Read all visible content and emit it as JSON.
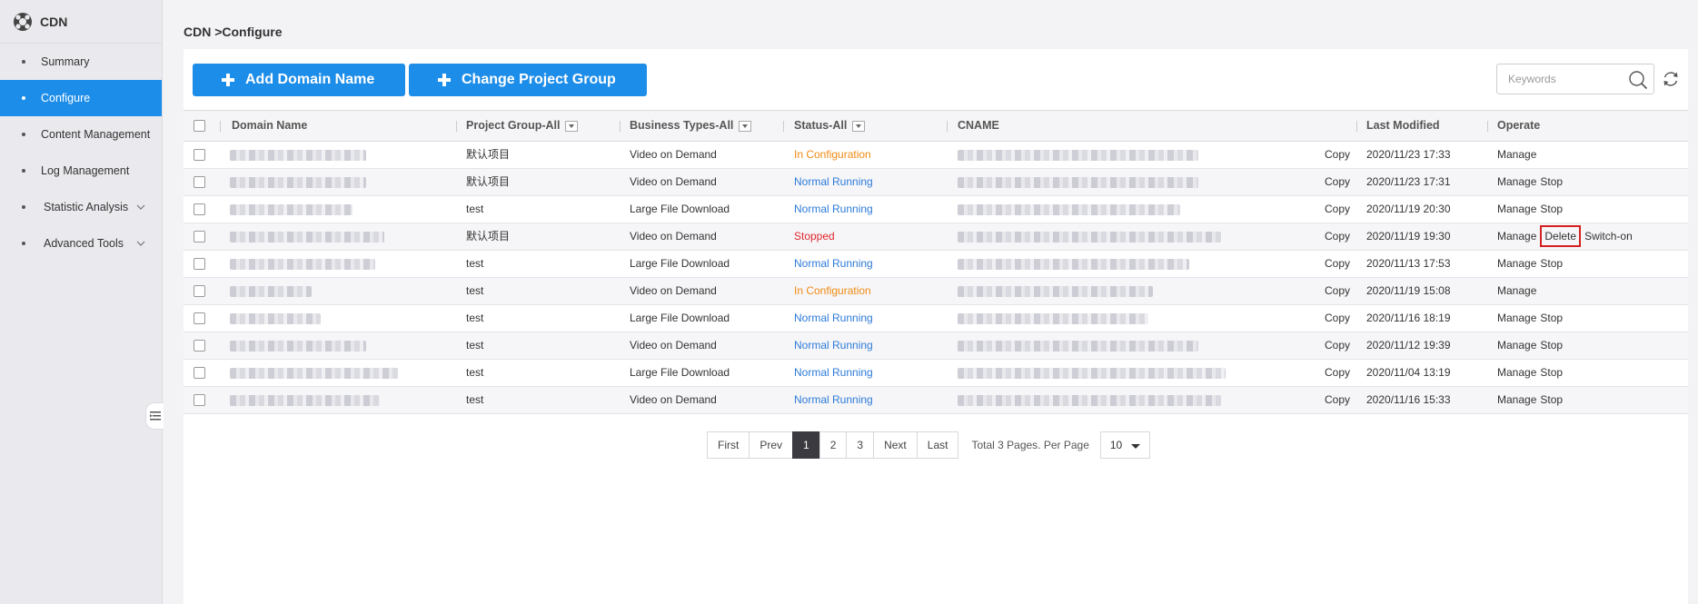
{
  "brand": {
    "name": "CDN"
  },
  "sidebar": {
    "items": [
      {
        "label": "Summary",
        "active": false,
        "expandable": false
      },
      {
        "label": "Configure",
        "active": true,
        "expandable": false
      },
      {
        "label": "Content Management",
        "active": false,
        "expandable": false
      },
      {
        "label": "Log Management",
        "active": false,
        "expandable": false
      },
      {
        "label": "Statistic Analysis",
        "active": false,
        "expandable": true
      },
      {
        "label": "Advanced Tools",
        "active": false,
        "expandable": true
      }
    ]
  },
  "breadcrumb": "CDN >Configure",
  "toolbar": {
    "add_label": "Add Domain Name",
    "change_label": "Change Project Group",
    "search_placeholder": "Keywords"
  },
  "table": {
    "headers": {
      "domain": "Domain Name",
      "project": "Project Group-All",
      "business": "Business Types-All",
      "status": "Status-All",
      "cname": "CNAME",
      "modified": "Last Modified",
      "operate": "Operate"
    },
    "rows": [
      {
        "project": "默认项目",
        "business": "Video on Demand",
        "status": "In Configuration",
        "status_type": "config",
        "copy": "Copy",
        "modified": "2020/11/23 17:33",
        "ops": [
          "Manage"
        ]
      },
      {
        "project": "默认项目",
        "business": "Video on Demand",
        "status": "Normal Running",
        "status_type": "run",
        "copy": "Copy",
        "modified": "2020/11/23 17:31",
        "ops": [
          "Manage",
          "Stop"
        ]
      },
      {
        "project": "test",
        "business": "Large File Download",
        "status": "Normal Running",
        "status_type": "run",
        "copy": "Copy",
        "modified": "2020/11/19 20:30",
        "ops": [
          "Manage",
          "Stop"
        ]
      },
      {
        "project": "默认项目",
        "business": "Video on Demand",
        "status": "Stopped",
        "status_type": "stop",
        "copy": "Copy",
        "modified": "2020/11/19 19:30",
        "ops": [
          "Manage",
          "Delete",
          "Switch-on"
        ]
      },
      {
        "project": "test",
        "business": "Large File Download",
        "status": "Normal Running",
        "status_type": "run",
        "copy": "Copy",
        "modified": "2020/11/13 17:53",
        "ops": [
          "Manage",
          "Stop"
        ]
      },
      {
        "project": "test",
        "business": "Video on Demand",
        "status": "In Configuration",
        "status_type": "config",
        "copy": "Copy",
        "modified": "2020/11/19 15:08",
        "ops": [
          "Manage"
        ]
      },
      {
        "project": "test",
        "business": "Large File Download",
        "status": "Normal Running",
        "status_type": "run",
        "copy": "Copy",
        "modified": "2020/11/16 18:19",
        "ops": [
          "Manage",
          "Stop"
        ]
      },
      {
        "project": "test",
        "business": "Video on Demand",
        "status": "Normal Running",
        "status_type": "run",
        "copy": "Copy",
        "modified": "2020/11/12 19:39",
        "ops": [
          "Manage",
          "Stop"
        ]
      },
      {
        "project": "test",
        "business": "Large File Download",
        "status": "Normal Running",
        "status_type": "run",
        "copy": "Copy",
        "modified": "2020/11/04 13:19",
        "ops": [
          "Manage",
          "Stop"
        ]
      },
      {
        "project": "test",
        "business": "Video on Demand",
        "status": "Normal Running",
        "status_type": "run",
        "copy": "Copy",
        "modified": "2020/11/16 15:33",
        "ops": [
          "Manage",
          "Stop"
        ]
      }
    ]
  },
  "pagination": {
    "first": "First",
    "prev": "Prev",
    "pages": [
      "1",
      "2",
      "3"
    ],
    "current": "1",
    "next": "Next",
    "last": "Last",
    "info": "Total 3 Pages. Per Page",
    "per_page": "10"
  },
  "colors": {
    "primary": "#1c8de9",
    "status_config": "#f08a14",
    "status_run": "#2e7bd8",
    "status_stop": "#e0262f"
  }
}
